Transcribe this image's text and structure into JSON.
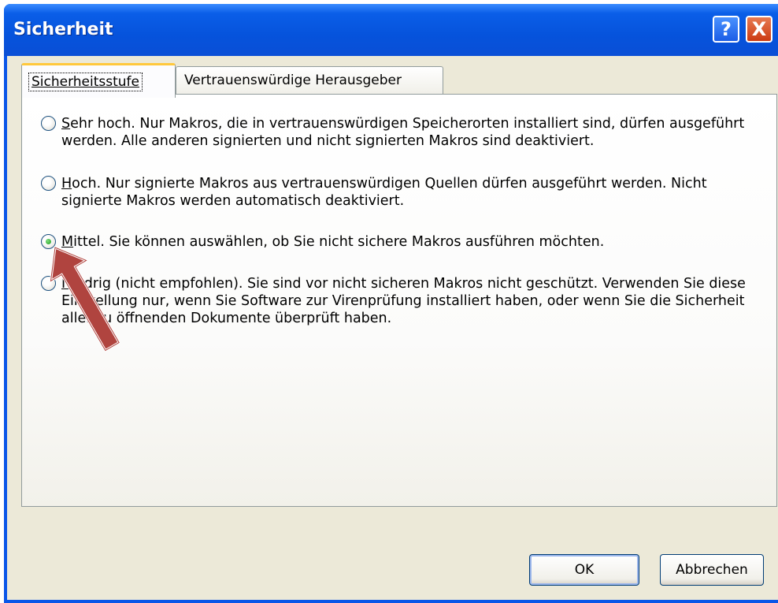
{
  "window": {
    "title": "Sicherheit",
    "help_label": "?",
    "close_label": "X"
  },
  "tabs": [
    {
      "label": "Sicherheitsstufe",
      "active": true
    },
    {
      "label": "Vertrauenswürdige Herausgeber",
      "active": false
    }
  ],
  "options": [
    {
      "accel": "S",
      "rest": "ehr hoch. Nur Makros, die in vertrauenswürdigen Speicherorten installiert sind, dürfen ausgeführt werden. Alle anderen signierten und nicht signierten Makros sind deaktiviert.",
      "checked": false
    },
    {
      "accel": "H",
      "rest": "och. Nur signierte Makros aus vertrauenswürdigen Quellen dürfen ausgeführt werden. Nicht signierte Makros werden automatisch deaktiviert.",
      "checked": false
    },
    {
      "accel": "M",
      "rest": "ittel. Sie können auswählen, ob Sie nicht sichere Makros ausführen möchten.",
      "checked": true
    },
    {
      "accel": "N",
      "rest": "iedrig (nicht empfohlen). Sie sind vor nicht sicheren Makros nicht geschützt. Verwenden Sie diese Einstellung nur, wenn Sie Software zur Virenprüfung installiert haben, oder wenn Sie die Sicherheit aller zu öffnenden Dokumente überprüft haben.",
      "checked": false
    }
  ],
  "buttons": {
    "ok": "OK",
    "cancel": "Abbrechen"
  },
  "colors": {
    "titlebar": "#0a56e8",
    "annotation_arrow": "#b0443f"
  }
}
